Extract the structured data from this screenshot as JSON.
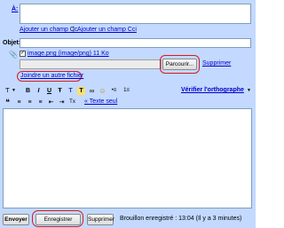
{
  "recipients": {
    "to_label": "À:",
    "to_value": "",
    "add_cc_label": "Ajouter un champ Cc",
    "separator": "|",
    "add_bcc_label": "Ajouter un champ Cci"
  },
  "subject": {
    "label": "Objet:",
    "value": ""
  },
  "attachments": {
    "file_label": "image.png (image/png) 11 Ko",
    "checked": true,
    "file_input_value": "",
    "browse_label": "Parcourir...",
    "remove_label": "Supprimer",
    "attach_another_label": "Joindre un autre fichier"
  },
  "format_toolbar": {
    "font_label": "Ƭ",
    "bold": "B",
    "italic": "I",
    "underline": "U",
    "font_size": "Ŧ",
    "text_color": "T",
    "highlight": "T",
    "smiley": "☺",
    "link": "∞",
    "numbered_list": "1≡",
    "bulleted_list": "•≡",
    "spellcheck_label": "Vérifier l'orthographe",
    "spellcheck_caret": "▼",
    "quote": "❝",
    "align_left": "≡",
    "align_center": "≡",
    "align_right": "≡",
    "indent_less": "⇤",
    "indent_more": "⇥",
    "remove_format": "Tx",
    "plain_text_label": "« Texte seul"
  },
  "body": {
    "value": ""
  },
  "footer": {
    "send_label": "Envoyer",
    "save_label": "Enregistrer",
    "delete_label": "Supprimer",
    "status_text": "Brouillon enregistré : 13:04 (Il y a 3 minutes)"
  },
  "colors": {
    "panel_bg": "#c3d9ff",
    "link": "#0000cc",
    "highlight_ring": "#d61a1a"
  }
}
